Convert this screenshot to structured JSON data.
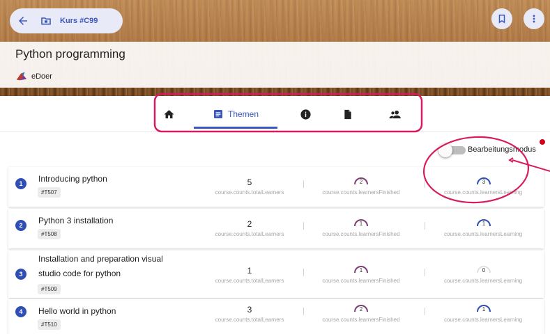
{
  "header": {
    "course_chip": "Kurs #C99",
    "course_title": "Python programming",
    "org_name": "eDoer"
  },
  "tabs": {
    "active_label": "Themen",
    "items": [
      "home-icon",
      "list-icon",
      "info-icon",
      "file-icon",
      "people-icon"
    ]
  },
  "edit_mode_label": "Bearbeitungsmodus",
  "topics": [
    {
      "num": "1",
      "title_lines": [
        "Introducing python"
      ],
      "tag": "#T507",
      "total_learners": "5",
      "finished": "2",
      "learning": "3",
      "total_label": "course.counts.totalLearners",
      "finished_label": "course.counts.learnersFinished",
      "learning_label": "course.counts.learnersLearning"
    },
    {
      "num": "2",
      "title_lines": [
        "Python 3 installation"
      ],
      "tag": "#T508",
      "total_learners": "2",
      "finished": "1",
      "learning": "1",
      "total_label": "course.counts.totalLearners",
      "finished_label": "course.counts.learnersFinished",
      "learning_label": "course.counts.learnersLearning"
    },
    {
      "num": "3",
      "title_lines": [
        "Installation and preparation visual",
        "studio code for python"
      ],
      "tag": "#T509",
      "total_learners": "1",
      "finished": "1",
      "learning": "0",
      "total_label": "course.counts.totalLearners",
      "finished_label": "course.counts.learnersFinished",
      "learning_label": "course.counts.learnersLearning"
    },
    {
      "num": "4",
      "title_lines": [
        "Hello world in python"
      ],
      "tag": "#T510",
      "total_learners": "3",
      "finished": "2",
      "learning": "1",
      "total_label": "course.counts.totalLearners",
      "finished_label": "course.counts.learnersFinished",
      "learning_label": "course.counts.learnersLearning"
    }
  ],
  "colors": {
    "primary": "#3a57c0",
    "finished_arc": "#7b3f74",
    "learning_arc": "#2f4fb5",
    "annotation": "#d81b60"
  }
}
